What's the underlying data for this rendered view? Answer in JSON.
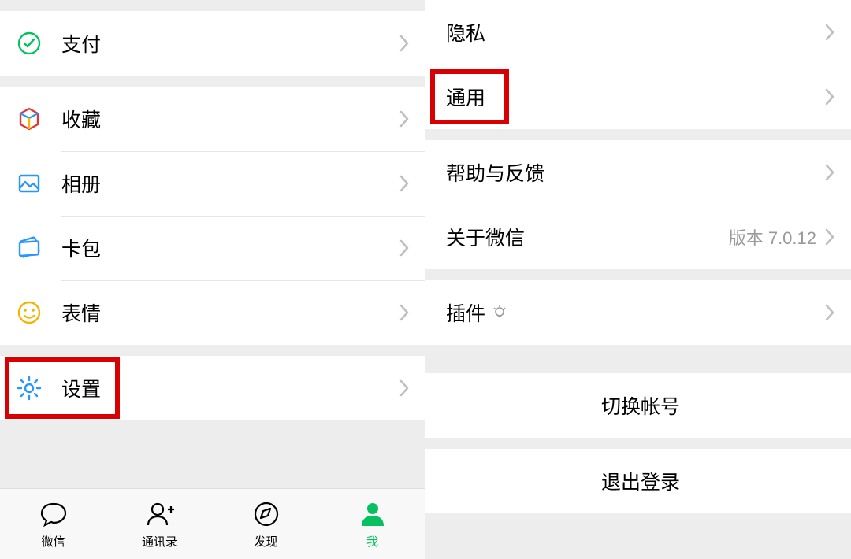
{
  "left": {
    "items": [
      {
        "label": "支付"
      },
      {
        "label": "收藏"
      },
      {
        "label": "相册"
      },
      {
        "label": "卡包"
      },
      {
        "label": "表情"
      },
      {
        "label": "设置"
      }
    ],
    "tabs": [
      {
        "label": "微信"
      },
      {
        "label": "通讯录"
      },
      {
        "label": "发现"
      },
      {
        "label": "我"
      }
    ]
  },
  "right": {
    "items": [
      {
        "label": "隐私"
      },
      {
        "label": "通用"
      },
      {
        "label": "帮助与反馈"
      },
      {
        "label": "关于微信",
        "meta": "版本 7.0.12"
      },
      {
        "label": "插件"
      },
      {
        "label": "切换帐号"
      },
      {
        "label": "退出登录"
      }
    ]
  }
}
